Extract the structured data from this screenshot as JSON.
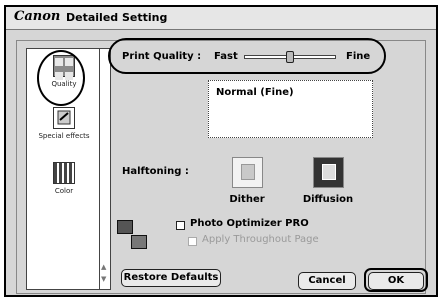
{
  "window": {
    "brand": "Canon",
    "title": "Detailed Setting"
  },
  "sidebar": {
    "items": [
      {
        "label": "Quality",
        "icon": "quality-icon"
      },
      {
        "label": "Special effects",
        "icon": "special-effects-icon"
      },
      {
        "label": "Color",
        "icon": "color-icon"
      }
    ]
  },
  "print_quality": {
    "label": "Print Quality :",
    "min_label": "Fast",
    "max_label": "Fine",
    "level": 0.5
  },
  "description": {
    "text": "Normal (Fine)"
  },
  "halftoning": {
    "label": "Halftoning :",
    "options": [
      {
        "label": "Dither",
        "selected": false
      },
      {
        "label": "Diffusion",
        "selected": true
      }
    ]
  },
  "photo_optimizer": {
    "label": "Photo Optimizer PRO",
    "checked": false
  },
  "apply_throughout": {
    "label": "Apply Throughout Page",
    "checked": false,
    "enabled": false
  },
  "buttons": {
    "restore": "Restore Defaults",
    "cancel": "Cancel",
    "ok": "OK"
  }
}
